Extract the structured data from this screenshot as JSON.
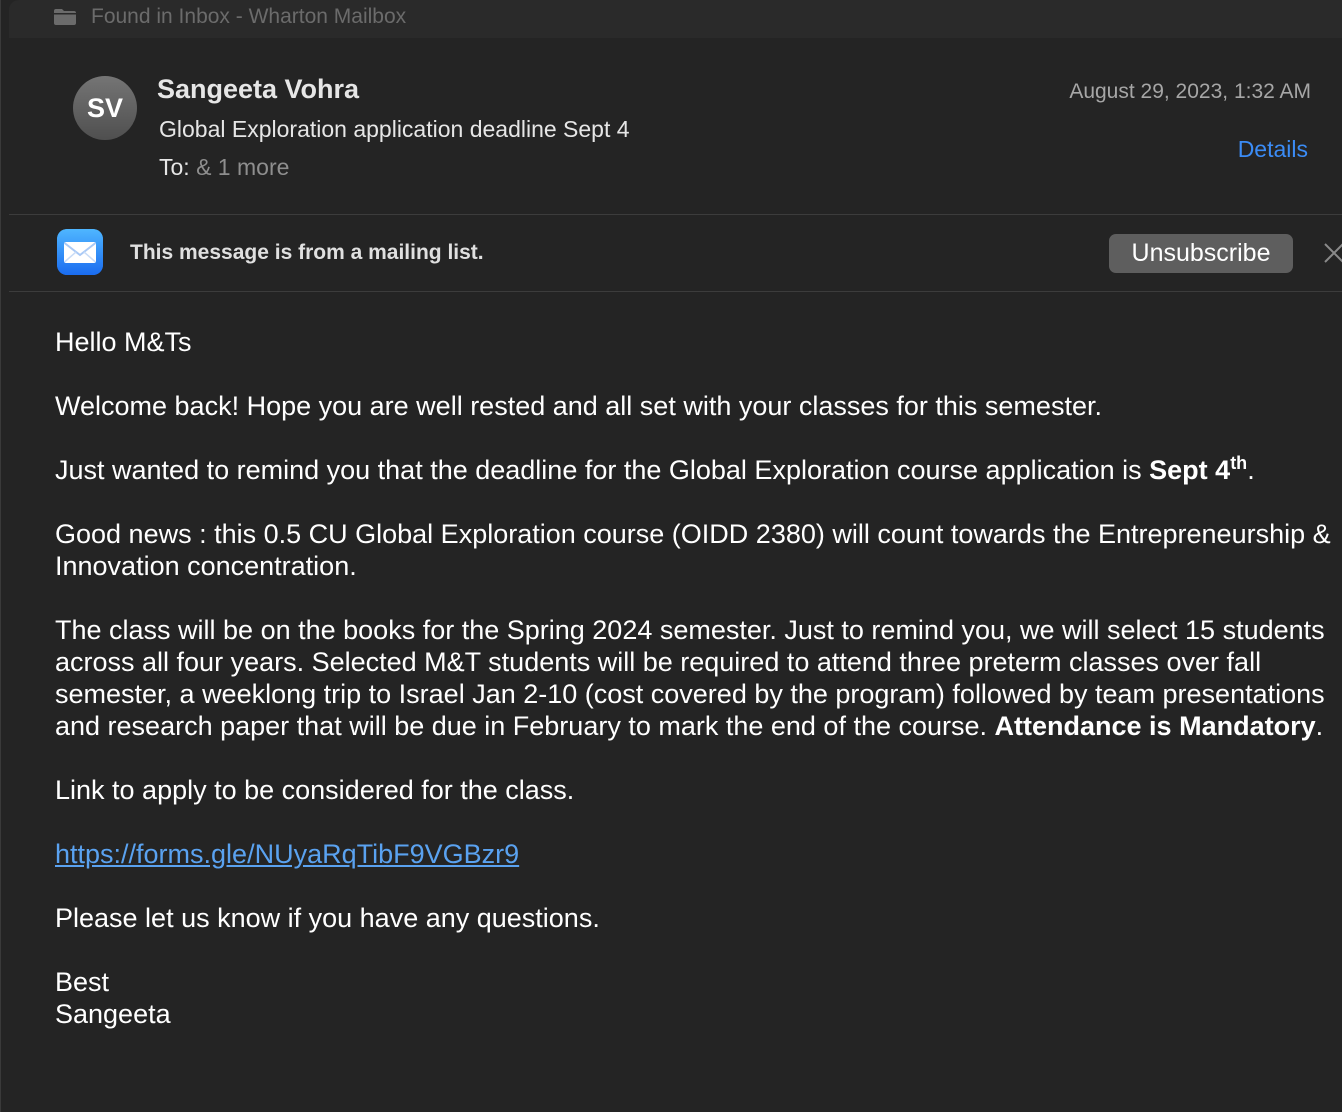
{
  "breadcrumb": {
    "icon": "folder-icon",
    "text": "Found in Inbox - Wharton Mailbox"
  },
  "header": {
    "avatar_initials": "SV",
    "sender": "Sangeeta Vohra",
    "subject": "Global Exploration application deadline Sept 4",
    "to_label": "To:",
    "to_more": "& 1 more",
    "date": "August 29, 2023, 1:32 AM",
    "details_label": "Details"
  },
  "banner": {
    "icon": "mail-app-icon",
    "text": "This message is from a mailing list.",
    "unsubscribe_label": "Unsubscribe",
    "close_icon": "close-icon"
  },
  "body": {
    "greeting": "Hello M&Ts",
    "p1": "Welcome back! Hope you are well rested and all set with your classes for this semester.",
    "p2_text": "Just wanted to remind you that the deadline for the Global Exploration course application is ",
    "p2_bold": "Sept 4",
    "p2_sup": "th",
    "p2_end": ".",
    "p3": "Good news : this  0.5 CU Global Exploration course (OIDD 2380) will count towards the Entrepreneurship & Innovation concentration.",
    "p4_text": "The class will be on the books for the Spring 2024 semester. Just to remind you, we will select 15 students across all four years. Selected M&T students will be required to attend three preterm classes over fall semester, a weeklong trip to Israel Jan 2-10 (cost covered by the program) followed by team presentations and research paper that will be due in February to mark the end of the course. ",
    "p4_bold": "Attendance is Mandatory",
    "p4_end": ".",
    "p5": "Link to apply to be considered for the class.",
    "link": "https://forms.gle/NUyaRqTibF9VGBzr9",
    "p6": "Please let us know if you have any questions.",
    "signoff": "Best",
    "signature": "Sangeeta"
  },
  "colors": {
    "background": "#242424",
    "link": "#5aa2f0",
    "details_link": "#3b8cf6",
    "button": "#5e5e5e"
  }
}
